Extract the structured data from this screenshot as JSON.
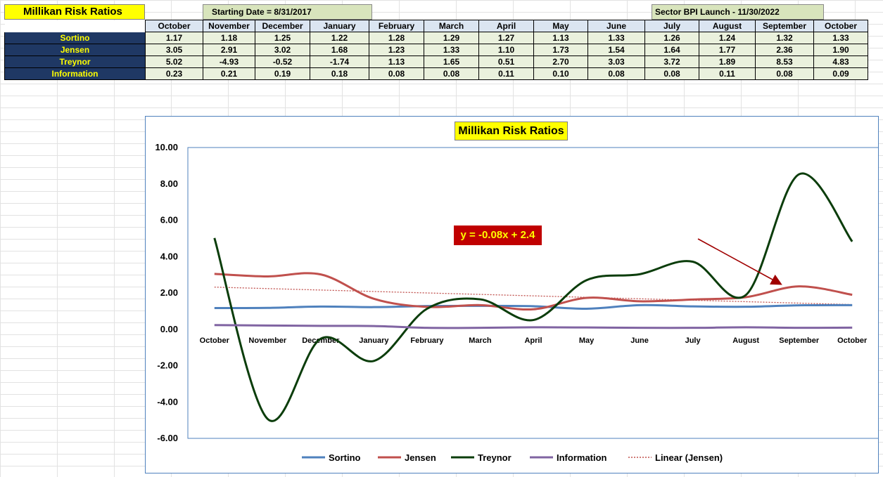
{
  "sheet": {
    "title": "Millikan Risk Ratios",
    "starting_date": "Starting Date = 8/31/2017",
    "launch_note": "Sector BPI Launch - 11/30/2022",
    "months": [
      "October",
      "November",
      "December",
      "January",
      "February",
      "March",
      "April",
      "May",
      "June",
      "July",
      "August",
      "September",
      "October"
    ],
    "rows": [
      {
        "label": "Sortino",
        "values": [
          "1.17",
          "1.18",
          "1.25",
          "1.22",
          "1.28",
          "1.29",
          "1.27",
          "1.13",
          "1.33",
          "1.26",
          "1.24",
          "1.32",
          "1.33"
        ]
      },
      {
        "label": "Jensen",
        "values": [
          "3.05",
          "2.91",
          "3.02",
          "1.68",
          "1.23",
          "1.33",
          "1.10",
          "1.73",
          "1.54",
          "1.64",
          "1.77",
          "2.36",
          "1.90"
        ]
      },
      {
        "label": "Treynor",
        "values": [
          "5.02",
          "-4.93",
          "-0.52",
          "-1.74",
          "1.13",
          "1.65",
          "0.51",
          "2.70",
          "3.03",
          "3.72",
          "1.89",
          "8.53",
          "4.83"
        ]
      },
      {
        "label": "Information",
        "values": [
          "0.23",
          "0.21",
          "0.19",
          "0.18",
          "0.08",
          "0.08",
          "0.11",
          "0.10",
          "0.08",
          "0.08",
          "0.11",
          "0.08",
          "0.09"
        ]
      }
    ]
  },
  "chart_data": {
    "type": "line",
    "title": "Millikan Risk Ratios",
    "categories": [
      "October",
      "November",
      "December",
      "January",
      "February",
      "March",
      "April",
      "May",
      "June",
      "July",
      "August",
      "September",
      "October"
    ],
    "ylim": [
      -6,
      10
    ],
    "yticks": [
      "10.00",
      "8.00",
      "6.00",
      "4.00",
      "2.00",
      "0.00",
      "-2.00",
      "-4.00",
      "-6.00"
    ],
    "grid": false,
    "legend_position": "bottom",
    "series": [
      {
        "name": "Sortino",
        "color": "#4f81bd",
        "values": [
          1.17,
          1.18,
          1.25,
          1.22,
          1.28,
          1.29,
          1.27,
          1.13,
          1.33,
          1.26,
          1.24,
          1.32,
          1.33
        ]
      },
      {
        "name": "Jensen",
        "color": "#c0504d",
        "values": [
          3.05,
          2.91,
          3.02,
          1.68,
          1.23,
          1.33,
          1.1,
          1.73,
          1.54,
          1.64,
          1.77,
          2.36,
          1.9
        ]
      },
      {
        "name": "Treynor",
        "color": "#0b3d0b",
        "values": [
          5.02,
          -4.93,
          -0.52,
          -1.74,
          1.13,
          1.65,
          0.51,
          2.7,
          3.03,
          3.72,
          1.89,
          8.53,
          4.83
        ]
      },
      {
        "name": "Information",
        "color": "#8064a2",
        "values": [
          0.23,
          0.21,
          0.19,
          0.18,
          0.08,
          0.08,
          0.11,
          0.1,
          0.08,
          0.08,
          0.11,
          0.08,
          0.09
        ]
      }
    ],
    "trendline": {
      "name": "Linear (Jensen)",
      "color": "#c0504d",
      "equation": "y = -0.08x + 2.4",
      "slope": -0.08,
      "intercept": 2.4
    },
    "annotation_arrow_color": "#a00000"
  }
}
